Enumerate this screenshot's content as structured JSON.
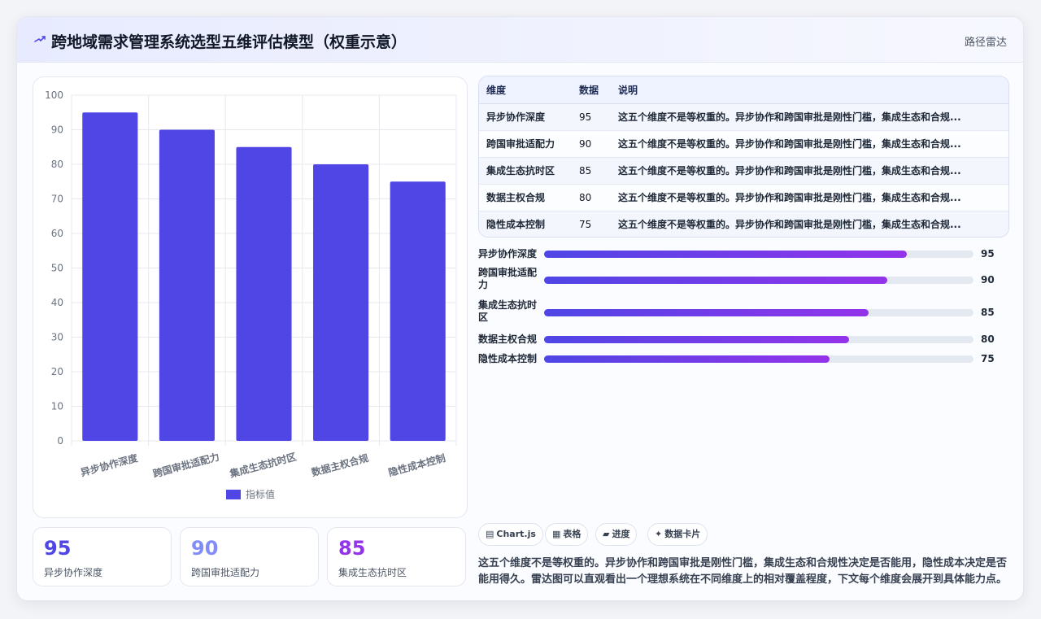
{
  "header": {
    "title": "跨地域需求管理系统选型五维评估模型（权重示意）",
    "badge": "路径雷达"
  },
  "colors": {
    "bar": "#4f46e5",
    "gradient_start": "#4f46e5",
    "gradient_end": "#9333ea",
    "stat_num_1": "#4f46e5",
    "stat_num_2": "#818cf8",
    "stat_num_3": "#9333ea"
  },
  "chart_data": {
    "type": "bar",
    "categories": [
      "异步协作深度",
      "跨国审批适配力",
      "集成生态抗时区",
      "数据主权合规",
      "隐性成本控制"
    ],
    "series": [
      {
        "name": "指标值",
        "values": [
          95,
          90,
          85,
          80,
          75
        ]
      }
    ],
    "ylim": [
      0,
      100
    ],
    "yticks": [
      0,
      10,
      20,
      30,
      40,
      50,
      60,
      70,
      80,
      90,
      100
    ],
    "grid": true,
    "legend": "bottom"
  },
  "table": {
    "headers": [
      "维度",
      "数据",
      "说明"
    ],
    "rows": [
      {
        "name": "异步协作深度",
        "value": "95",
        "desc": "这五个维度不是等权重的。异步协作和跨国审批是刚性门槛，集成生态和合规..."
      },
      {
        "name": "跨国审批适配力",
        "value": "90",
        "desc": "这五个维度不是等权重的。异步协作和跨国审批是刚性门槛，集成生态和合规..."
      },
      {
        "name": "集成生态抗时区",
        "value": "85",
        "desc": "这五个维度不是等权重的。异步协作和跨国审批是刚性门槛，集成生态和合规..."
      },
      {
        "name": "数据主权合规",
        "value": "80",
        "desc": "这五个维度不是等权重的。异步协作和跨国审批是刚性门槛，集成生态和合规..."
      },
      {
        "name": "隐性成本控制",
        "value": "75",
        "desc": "这五个维度不是等权重的。异步协作和跨国审批是刚性门槛，集成生态和合规..."
      }
    ]
  },
  "progress": [
    {
      "name": "异步协作深度",
      "value": 95,
      "label": "95",
      "fraction": 0.845
    },
    {
      "name": "跨国审批适配力",
      "value": 90,
      "label": "90",
      "fraction": 0.8
    },
    {
      "name": "集成生态抗时区",
      "value": 85,
      "label": "85",
      "fraction": 0.755
    },
    {
      "name": "数据主权合规",
      "value": 80,
      "label": "80",
      "fraction": 0.71
    },
    {
      "name": "隐性成本控制",
      "value": 75,
      "label": "75",
      "fraction": 0.665
    }
  ],
  "stats": [
    {
      "num": "95",
      "label": "异步协作深度"
    },
    {
      "num": "90",
      "label": "跨国审批适配力"
    },
    {
      "num": "85",
      "label": "集成生态抗时区"
    }
  ],
  "chips": [
    {
      "icon": "▤",
      "label": "Chart.js",
      "icon_name": "chart-icon"
    },
    {
      "icon": "▦",
      "label": "表格",
      "icon_name": "table-icon"
    },
    {
      "icon": "▰",
      "label": "进度",
      "icon_name": "progress-icon"
    },
    {
      "icon": "✦",
      "label": "数据卡片",
      "icon_name": "card-icon"
    }
  ],
  "description": "这五个维度不是等权重的。异步协作和跨国审批是刚性门槛，集成生态和合规性决定是否能用，隐性成本决定是否能用得久。雷达图可以直观看出一个理想系统在不同维度上的相对覆盖程度，下文每个维度会展开到具体能力点。"
}
